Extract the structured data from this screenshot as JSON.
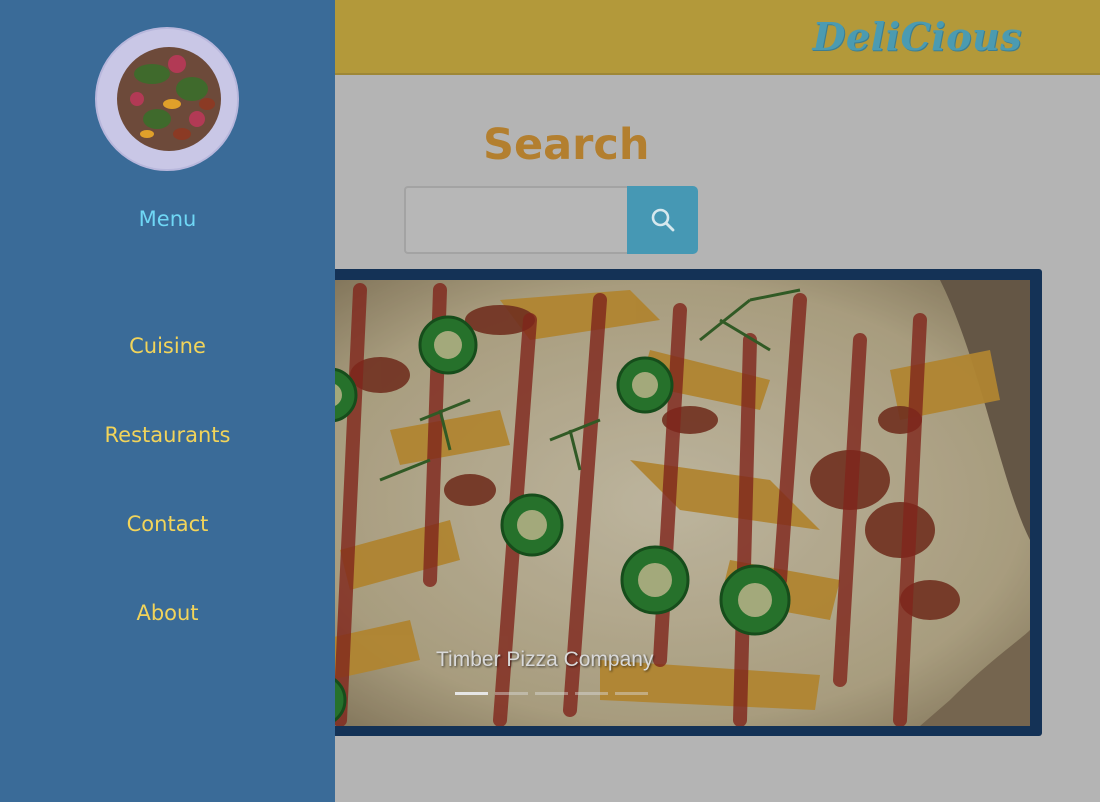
{
  "header": {
    "brand": "DeliCious"
  },
  "search": {
    "title": "Search",
    "value": "",
    "icon": "search-icon"
  },
  "carousel": {
    "caption": "Timber Pizza Company",
    "slide_count": 5,
    "active_index": 0
  },
  "sidebar": {
    "menu_title": "Menu",
    "items": [
      {
        "label": "Cuisine"
      },
      {
        "label": "Restaurants"
      },
      {
        "label": "Contact"
      },
      {
        "label": "About"
      }
    ]
  },
  "colors": {
    "sidebar_bg": "#3a6b98",
    "header_bg": "#b3993a",
    "brand_text": "#4b9bb1",
    "search_title": "#b37f2f",
    "search_button": "#4698b4",
    "menu_title": "#6fd7f5",
    "menu_item": "#f2d45a",
    "carousel_frame": "#143256"
  }
}
